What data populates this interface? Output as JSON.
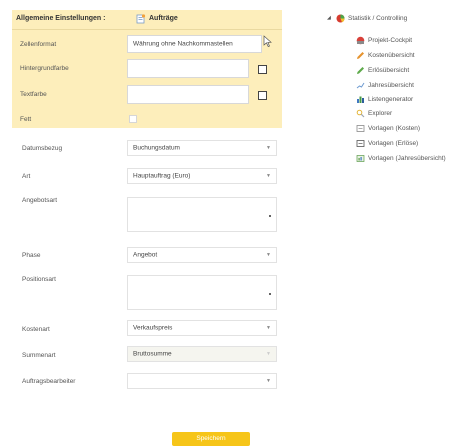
{
  "header": {
    "title": "Allgemeine Einstellungen :",
    "tab": "Aufträge"
  },
  "settings": {
    "zellenformat": {
      "label": "Zellenformat",
      "value": "Währung ohne Nachkommastellen"
    },
    "hintergrundfarbe": {
      "label": "Hintergrundfarbe"
    },
    "textfarbe": {
      "label": "Textfarbe"
    },
    "fett": {
      "label": "Fett"
    }
  },
  "form": {
    "datumsbezug": {
      "label": "Datumsbezug",
      "value": "Buchungsdatum"
    },
    "art": {
      "label": "Art",
      "value": "Hauptauftrag (Euro)"
    },
    "angebotsart": {
      "label": "Angebotsart"
    },
    "phase": {
      "label": "Phase",
      "value": "Angebot"
    },
    "positionsart": {
      "label": "Positionsart"
    },
    "kostenart": {
      "label": "Kostenart",
      "value": "Verkaufspreis"
    },
    "summenart": {
      "label": "Summenart",
      "value": "Bruttosumme"
    },
    "auftragsbearbeiter": {
      "label": "Auftragsbearbeiter",
      "value": ""
    }
  },
  "save_label": "Speichern",
  "tree": {
    "root": "Statistik / Controlling",
    "items": [
      {
        "label": "Projekt-Cockpit",
        "icon": "cockpit-icon"
      },
      {
        "label": "Kostenübersicht",
        "icon": "pencil-orange-icon"
      },
      {
        "label": "Erlösübersicht",
        "icon": "pencil-green-icon"
      },
      {
        "label": "Jahresübersicht",
        "icon": "line-chart-icon"
      },
      {
        "label": "Listengenerator",
        "icon": "bar-chart-icon"
      },
      {
        "label": "Explorer",
        "icon": "explorer-icon"
      },
      {
        "label": "Vorlagen (Kosten)",
        "icon": "template-icon"
      },
      {
        "label": "Vorlagen (Erlöse)",
        "icon": "template-icon"
      },
      {
        "label": "Vorlagen (Jahresübersicht)",
        "icon": "template-chart-icon"
      }
    ]
  },
  "colors": {
    "panel": "#fdeebb",
    "accent": "#f6c519"
  }
}
